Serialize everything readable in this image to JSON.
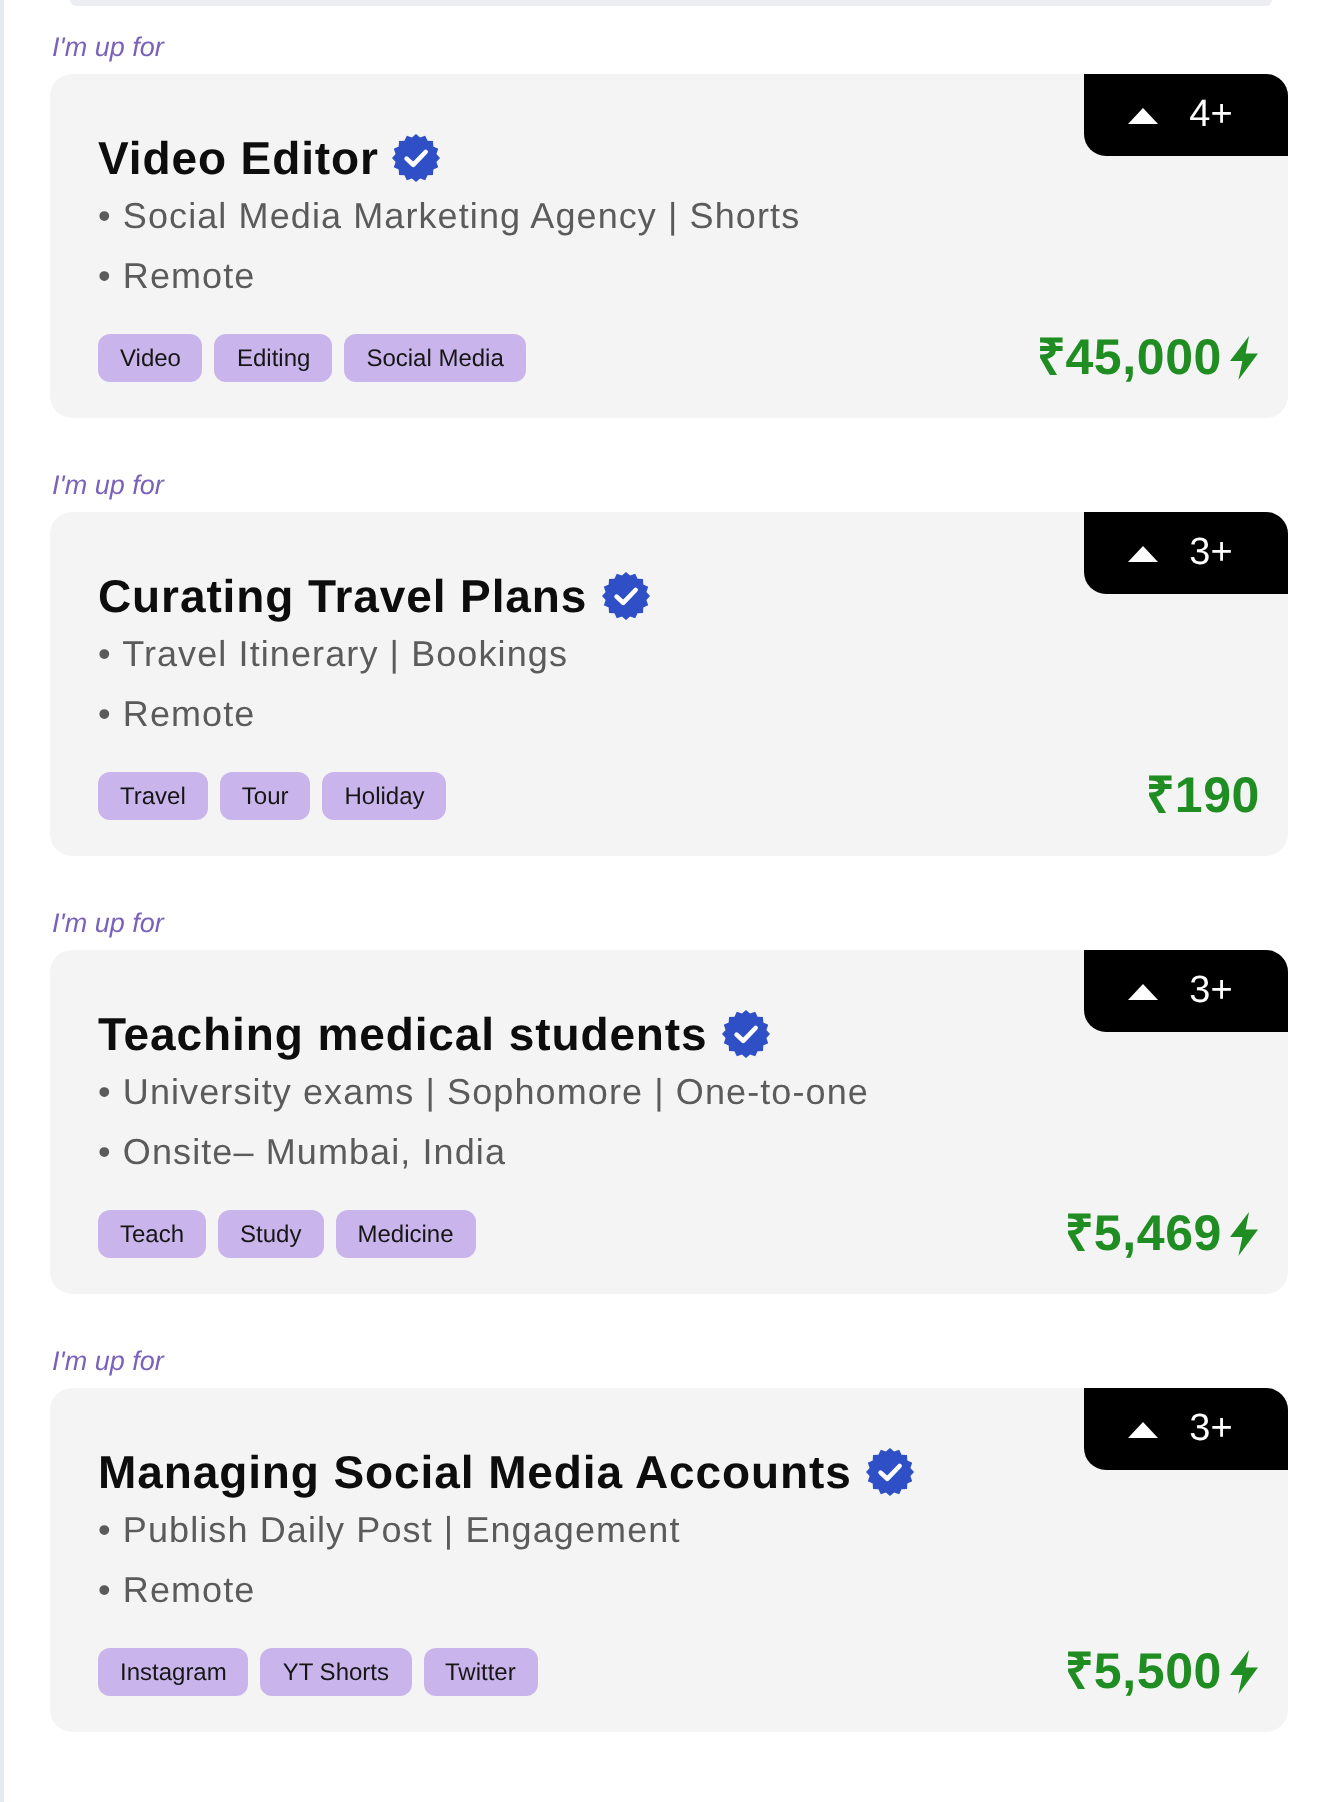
{
  "listings": [
    {
      "label": "I'm up for",
      "title": "Video Editor",
      "verified": true,
      "upvotes": "4+",
      "details": [
        "• Social Media Marketing Agency | Shorts",
        "• Remote"
      ],
      "tags": [
        "Video",
        "Editing",
        "Social Media"
      ],
      "price": "₹45,000",
      "boosted": true
    },
    {
      "label": "I'm up for",
      "title": "Curating Travel Plans",
      "verified": true,
      "upvotes": "3+",
      "details": [
        "• Travel Itinerary | Bookings",
        "• Remote"
      ],
      "tags": [
        "Travel",
        "Tour",
        "Holiday"
      ],
      "price": "₹190",
      "boosted": false
    },
    {
      "label": "I'm up for",
      "title": "Teaching medical students",
      "verified": true,
      "upvotes": "3+",
      "details": [
        "• University exams | Sophomore | One-to-one",
        "• Onsite– Mumbai, India"
      ],
      "tags": [
        "Teach",
        "Study",
        "Medicine"
      ],
      "price": "₹5,469",
      "boosted": true
    },
    {
      "label": "I'm up for",
      "title": "Managing Social Media Accounts",
      "verified": true,
      "upvotes": "3+",
      "details": [
        "• Publish Daily Post | Engagement",
        "• Remote"
      ],
      "tags": [
        "Instagram",
        "YT Shorts",
        "Twitter"
      ],
      "price": "₹5,500",
      "boosted": true
    }
  ]
}
